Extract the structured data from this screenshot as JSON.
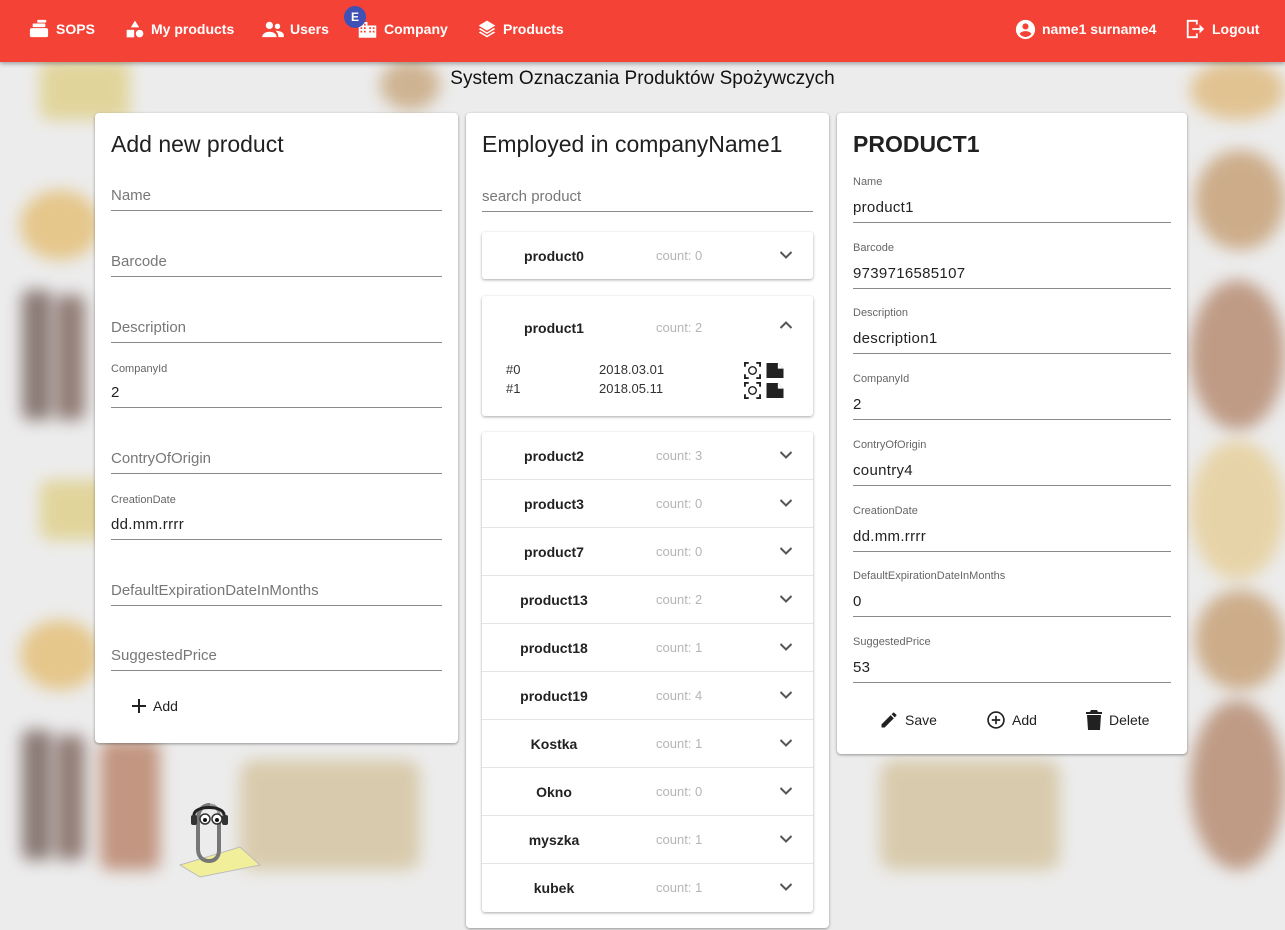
{
  "nav": {
    "brand": "SOPS",
    "my_products": "My products",
    "users": "Users",
    "company": "Company",
    "company_badge": "E",
    "products": "Products",
    "user": "name1 surname4",
    "logout": "Logout"
  },
  "page_title": "System Oznaczania Produktów Spożywczych",
  "add_form": {
    "title": "Add new product",
    "fields": {
      "name": "Name",
      "barcode": "Barcode",
      "description": "Description",
      "companyid_label": "CompanyId",
      "companyid_value": "2",
      "country": "ContryOfOrigin",
      "creation_label": "CreationDate",
      "creation_value": "dd.mm.rrrr",
      "expiration": "DefaultExpirationDateInMonths",
      "price": "SuggestedPrice"
    },
    "add_label": "Add"
  },
  "product_list": {
    "title": "Employed in companyName1",
    "search_placeholder": "search product",
    "first": {
      "name": "product0",
      "count": "count: 0"
    },
    "expanded": {
      "name": "product1",
      "count": "count: 2",
      "items": [
        {
          "index": "#0",
          "date": "2018.03.01"
        },
        {
          "index": "#1",
          "date": "2018.05.11"
        }
      ]
    },
    "rows": [
      {
        "name": "product2",
        "count": "count: 3"
      },
      {
        "name": "product3",
        "count": "count: 0"
      },
      {
        "name": "product7",
        "count": "count: 0"
      },
      {
        "name": "product13",
        "count": "count: 2"
      },
      {
        "name": "product18",
        "count": "count: 1"
      },
      {
        "name": "product19",
        "count": "count: 4"
      },
      {
        "name": "Kostka",
        "count": "count: 1"
      },
      {
        "name": "Okno",
        "count": "count: 0"
      },
      {
        "name": "myszka",
        "count": "count: 1"
      },
      {
        "name": "kubek",
        "count": "count: 1"
      }
    ]
  },
  "detail": {
    "title": "PRODUCT1",
    "fields": [
      {
        "label": "Name",
        "value": "product1"
      },
      {
        "label": "Barcode",
        "value": "9739716585107"
      },
      {
        "label": "Description",
        "value": "description1"
      },
      {
        "label": "CompanyId",
        "value": "2"
      },
      {
        "label": "ContryOfOrigin",
        "value": "country4"
      },
      {
        "label": "CreationDate",
        "value": "dd.mm.rrrr"
      },
      {
        "label": "DefaultExpirationDateInMonths",
        "value": "0"
      },
      {
        "label": "SuggestedPrice",
        "value": "53"
      }
    ],
    "save_label": "Save",
    "add_label": "Add",
    "delete_label": "Delete"
  },
  "colors": {
    "accent": "#f44336",
    "badge": "#3f51b5"
  }
}
